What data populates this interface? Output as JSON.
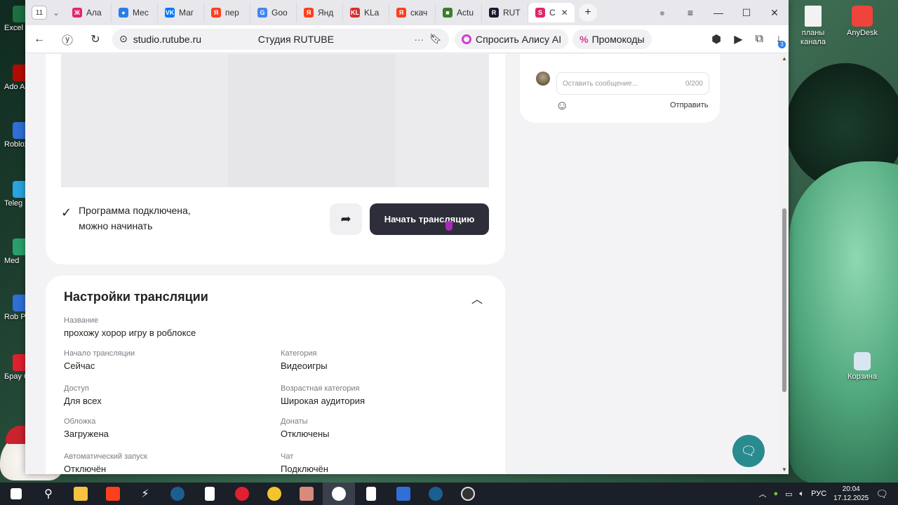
{
  "browser": {
    "tab_count": "11",
    "tabs": [
      {
        "label": "Ала",
        "color": "#e3256b",
        "glyph": "Ж"
      },
      {
        "label": "Мес",
        "color": "#2b7de9",
        "glyph": "●"
      },
      {
        "label": "Маг",
        "color": "#0077ff",
        "glyph": "VK"
      },
      {
        "label": "пер",
        "color": "#fc3f1d",
        "glyph": "Я"
      },
      {
        "label": "Goo",
        "color": "#4285f4",
        "glyph": "G"
      },
      {
        "label": "Янд",
        "color": "#fc3f1d",
        "glyph": "Я"
      },
      {
        "label": "KLa",
        "color": "#d32f2f",
        "glyph": "KL"
      },
      {
        "label": "скач",
        "color": "#fc3f1d",
        "glyph": "Я"
      },
      {
        "label": "Actu",
        "color": "#3a7d2c",
        "glyph": "■"
      },
      {
        "label": "RUT",
        "color": "#1a1a2e",
        "glyph": "R"
      },
      {
        "label": "С",
        "color": "#e3256b",
        "glyph": "S",
        "active": true
      }
    ],
    "close_tab": "✕",
    "new_tab": "+",
    "window_controls": {
      "minimize": "—",
      "menu": "≡",
      "maximize": "☐",
      "close": "✕"
    },
    "address": {
      "domain": "studio.rutube.ru",
      "page_title": "Студия RUTUBE",
      "more": "···"
    },
    "alisa_label": "Спросить Алису AI",
    "promo_label": "Промокоды",
    "downloads_badge": "3"
  },
  "chat": {
    "placeholder": "Оставить сообщение...",
    "counter": "0/200",
    "send_label": "Отправить"
  },
  "stream": {
    "status_line1": "Программа подключена,",
    "status_line2": "можно начинать",
    "start_button": "Начать трансляцию"
  },
  "settings": {
    "title": "Настройки трансляции",
    "fields": {
      "name": {
        "label": "Название",
        "value": "прохожу хорор игру в роблоксе"
      },
      "start": {
        "label": "Начало трансляции",
        "value": "Сейчас"
      },
      "category": {
        "label": "Категория",
        "value": "Видеоигры"
      },
      "access": {
        "label": "Доступ",
        "value": "Для всех"
      },
      "age": {
        "label": "Возрастная категория",
        "value": "Широкая аудитория"
      },
      "cover": {
        "label": "Обложка",
        "value": "Загружена"
      },
      "donations": {
        "label": "Донаты",
        "value": "Отключены"
      },
      "autostart": {
        "label": "Автоматический запуск",
        "value": "Отключён"
      },
      "chat": {
        "label": "Чат",
        "value": "Подключён"
      }
    }
  },
  "desktop": {
    "right_icons": [
      {
        "label": "планы канала",
        "color": "#f2f2f2"
      },
      {
        "label": "AnyDesk",
        "color": "#ef443b"
      },
      {
        "label": "Корзина",
        "color": "#d9e6f2"
      }
    ],
    "left_icons": [
      "Excel",
      "Ado Acro",
      "Roblox",
      "Teleg",
      "Med",
      "Rob Pla",
      "Брау Op"
    ]
  },
  "taskbar": {
    "language": "РУС",
    "time": "20:04",
    "date": "17.12.2025"
  }
}
